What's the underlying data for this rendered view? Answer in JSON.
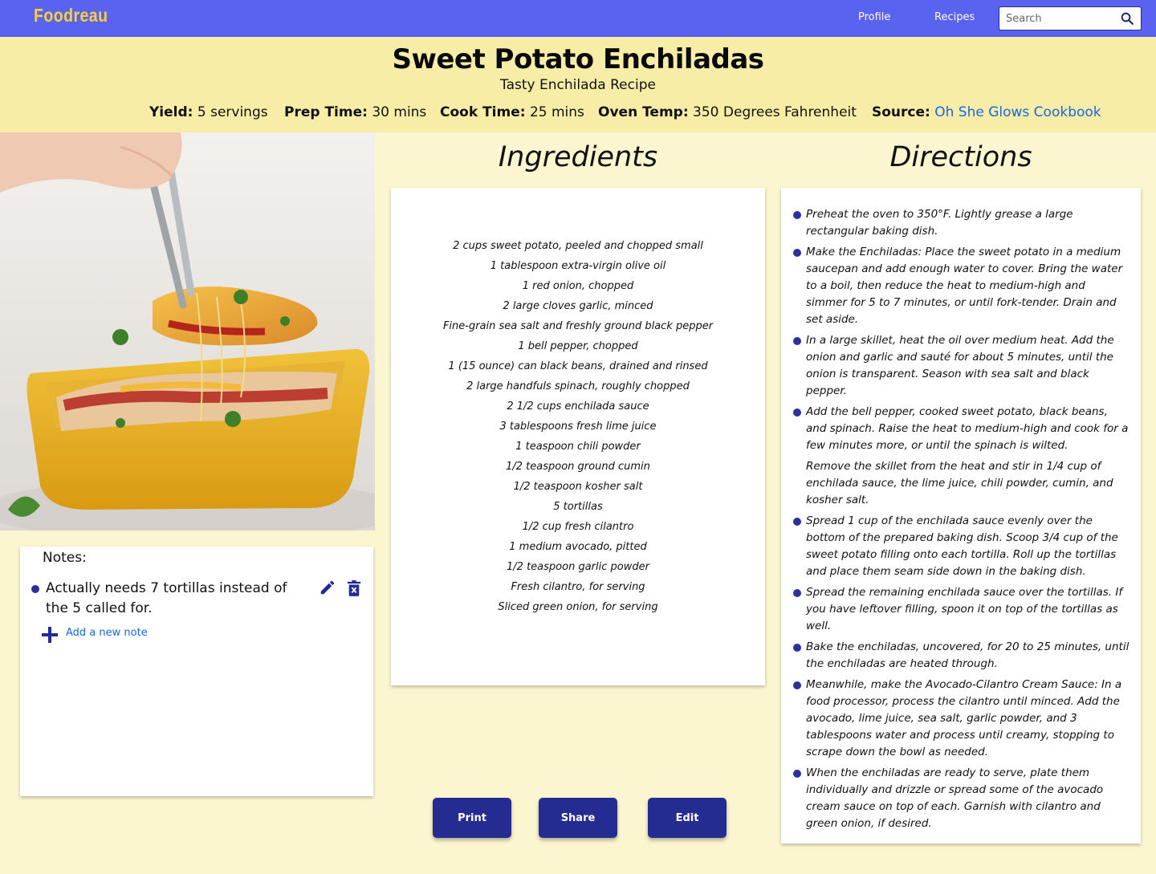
{
  "nav": {
    "brand": "Foodreau",
    "links": {
      "profile": "Profile",
      "recipes": "Recipes"
    },
    "search": {
      "placeholder": "Search",
      "value": ""
    }
  },
  "recipe": {
    "title": "Sweet Potato Enchiladas",
    "subtitle": "Tasty Enchilada Recipe",
    "meta": {
      "yield_label": "Yield:",
      "yield_value": "5 servings",
      "prep_label": "Prep Time:",
      "prep_value": "30 mins",
      "cook_label": "Cook Time:",
      "cook_value": "25 mins",
      "oven_label": "Oven Temp:",
      "oven_value": "350 Degrees Fahrenheit",
      "source_label": "Source:",
      "source_value": "Oh She Glows Cookbook"
    }
  },
  "notes": {
    "title": "Notes:",
    "items": [
      "Actually needs 7 tortillas instead of the 5 called for."
    ],
    "add_label": "Add a new note"
  },
  "ingredients": {
    "heading": "Ingredients",
    "items": [
      "2 cups sweet potato, peeled and chopped small",
      "1 tablespoon extra-virgin olive oil",
      "1 red onion, chopped",
      "2 large cloves garlic, minced",
      "Fine-grain sea salt and freshly ground black pepper",
      "1 bell pepper, chopped",
      "1 (15 ounce) can black beans, drained and rinsed",
      "2 large handfuls spinach, roughly chopped",
      "2 1/2 cups enchilada sauce",
      "3 tablespoons fresh lime juice",
      "1 teaspoon chili powder",
      "1/2 teaspoon ground cumin",
      "1/2 teaspoon kosher salt",
      "5 tortillas",
      "1/2 cup fresh cilantro",
      "1 medium avocado, pitted",
      "1/2 teaspoon garlic powder",
      "Fresh cilantro, for serving",
      "Sliced green onion, for serving"
    ]
  },
  "directions": {
    "heading": "Directions",
    "steps": [
      "Preheat the oven to 350°F. Lightly grease a large rectangular baking dish.",
      "Make the Enchiladas: Place the sweet potato in a medium saucepan and add enough water to cover. Bring the water to a boil, then reduce the heat to medium-high and simmer for 5 to 7 minutes, or until fork-tender. Drain and set aside.",
      "In a large skillet, heat the oil over medium heat. Add the onion and garlic and sauté for about 5 minutes, until the onion is transparent. Season with sea salt and black pepper.",
      "Add the bell pepper, cooked sweet potato, black beans, and spinach. Raise the heat to medium-high and cook for a few minutes more, or until the spinach is wilted.",
      "Remove the skillet from the heat and stir in 1/4 cup of enchilada sauce, the lime juice, chili powder, cumin, and kosher salt.",
      "Spread 1 cup of the enchilada sauce evenly over the bottom of the prepared baking dish. Scoop 3/4 cup of the sweet potato filling onto each tortilla. Roll up the tortillas and place them seam side down in the baking dish.",
      "Spread the remaining enchilada sauce over the tortillas. If you have leftover filling, spoon it on top of the tortillas as well.",
      "Bake the enchiladas, uncovered, for 20 to 25 minutes, until the enchiladas are heated through.",
      "Meanwhile, make the Avocado-Cilantro Cream Sauce: In a food processor, process the cilantro until minced. Add the avocado, lime juice, sea salt, garlic powder, and 3 tablespoons water and process until creamy, stopping to scrape down the bowl as needed.",
      "When the enchiladas are ready to serve, plate them individually and drizzle or spread some of the avocado cream sauce on top of each. Garnish with cilantro and green onion, if desired."
    ]
  },
  "actions": {
    "print": "Print",
    "share": "Share",
    "edit": "Edit"
  },
  "colors": {
    "nav": "#5a63f0",
    "brand": "#f4d03f",
    "header": "#f8eda6",
    "page": "#fbf6cf",
    "button": "#252c91",
    "link": "#1a66e0"
  }
}
